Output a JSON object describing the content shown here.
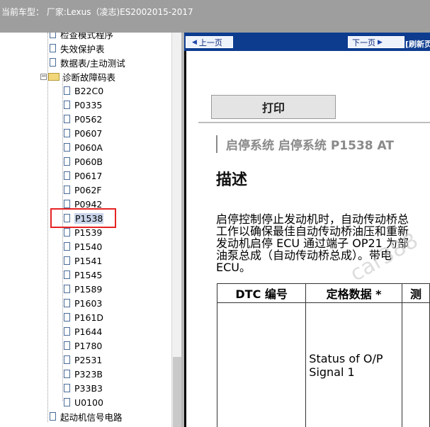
{
  "topbar": {
    "title": "当前车型： 厂家:Lexus（凌志)ES2002015-2017"
  },
  "tree": {
    "items": [
      {
        "label": "检查模式程序"
      },
      {
        "label": "失效保护表"
      },
      {
        "label": "数据表/主动测试"
      },
      {
        "label": "诊断故障码表"
      },
      {
        "label": "B22C0"
      },
      {
        "label": "P0335"
      },
      {
        "label": "P0562"
      },
      {
        "label": "P0607"
      },
      {
        "label": "P060A"
      },
      {
        "label": "P060B"
      },
      {
        "label": "P0617"
      },
      {
        "label": "P062F"
      },
      {
        "label": "P0942"
      },
      {
        "label": "P1538"
      },
      {
        "label": "P1539"
      },
      {
        "label": "P1540"
      },
      {
        "label": "P1541"
      },
      {
        "label": "P1545"
      },
      {
        "label": "P1589"
      },
      {
        "label": "P1603"
      },
      {
        "label": "P161D"
      },
      {
        "label": "P1644"
      },
      {
        "label": "P1780"
      },
      {
        "label": "P2531"
      },
      {
        "label": "P323B"
      },
      {
        "label": "P33B3"
      },
      {
        "label": "U0100"
      },
      {
        "label": "起动机信号电路"
      }
    ]
  },
  "nav": {
    "prev": "上一页",
    "next": "下一页",
    "refresh": "[刷新页"
  },
  "content": {
    "print": "打印",
    "breadcrumb": "启停系统  启停系统  P1538  AT",
    "heading": "描述",
    "para": [
      "启停控制停止发动机时，自动传动桥总",
      "工作以确保最佳自动传动桥油压和重新",
      "发动机启停 ECU 通过端子 OP21 为部",
      "油泵总成（自动传动桥总成）。带电",
      "ECU。"
    ],
    "table": {
      "headers": [
        "DTC 编号",
        "定格数据 *",
        "测"
      ],
      "row_cell": "Status of O/P Signal 1"
    },
    "watermark": "car388"
  }
}
